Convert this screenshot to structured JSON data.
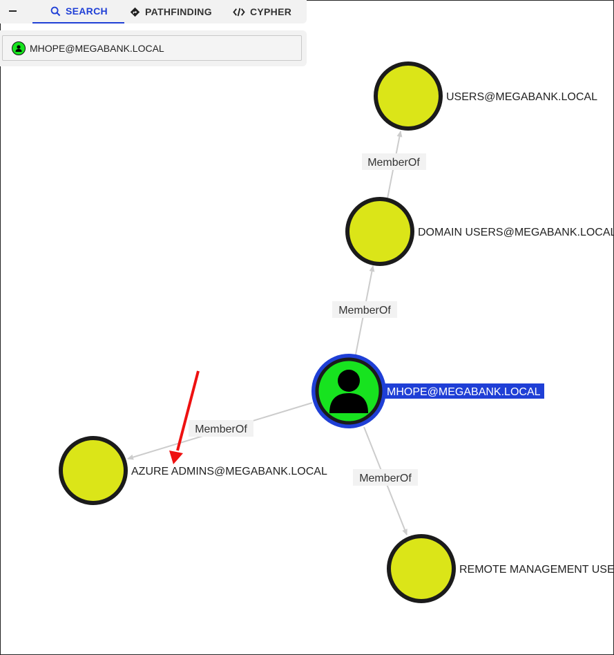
{
  "tabs": {
    "collapse": "collapse",
    "search": "SEARCH",
    "pathfinding": "PATHFINDING",
    "cypher": "CYPHER"
  },
  "search": {
    "value": "MHOPE@MEGABANK.LOCAL"
  },
  "graph": {
    "nodes": {
      "mhope": "MHOPE@MEGABANK.LOCAL",
      "users": "USERS@MEGABANK.LOCAL",
      "domain_users": "DOMAIN USERS@MEGABANK.LOCAL",
      "azure_admins": "AZURE ADMINS@MEGABANK.LOCAL",
      "remote_management": "REMOTE MANAGEMENT USE"
    },
    "edges": {
      "to_users": "MemberOf",
      "to_domain_users": "MemberOf",
      "to_azure_admins": "MemberOf",
      "to_remote_management": "MemberOf"
    }
  },
  "colors": {
    "group_node": "#dbe518",
    "user_node": "#17e31f",
    "selected_ring": "#1f3fd6",
    "edge": "#cccccc",
    "annotation_arrow": "#ee1111"
  }
}
